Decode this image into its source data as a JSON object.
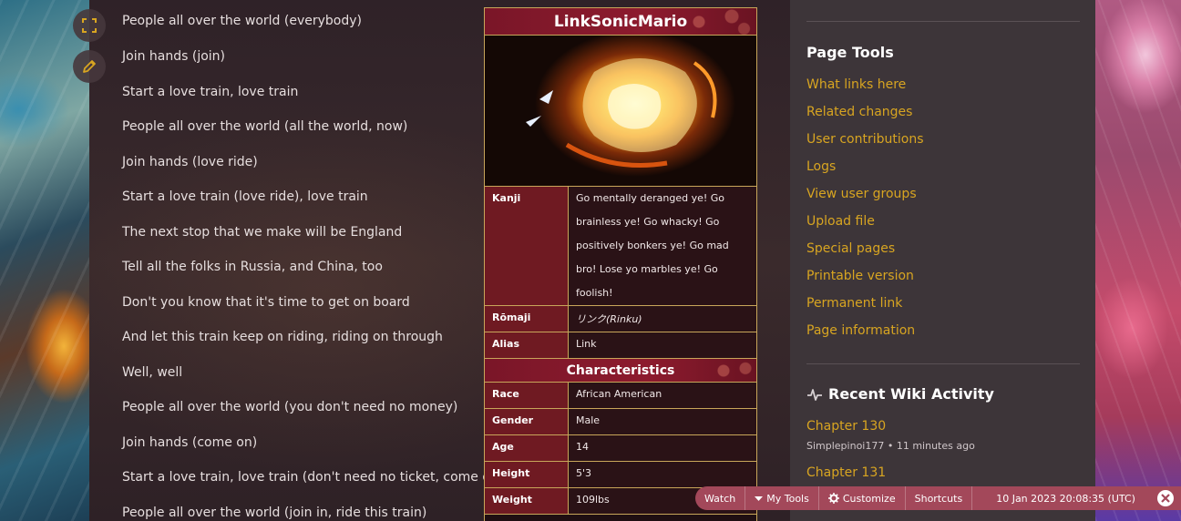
{
  "lyrics": [
    "People all over the world (everybody)",
    "Join hands (join)",
    "Start a love train, love train",
    "People all over the world (all the world, now)",
    "Join hands (love ride)",
    "Start a love train (love ride), love train",
    "The next stop that we make will be England",
    "Tell all the folks in Russia, and China, too",
    "Don't you know that it's time to get on board",
    "And let this train keep on riding, riding on through",
    "Well, well",
    "People all over the world (you don't need no money)",
    "Join hands (come on)",
    "Start a love train, love train (don't need no ticket, come on)",
    "People all over the world (join in, ride this train)"
  ],
  "infobox": {
    "title": "LinkSonicMario",
    "rows": [
      {
        "label": "Kanji",
        "value": "Go mentally deranged ye! Go brainless ye! Go whacky! Go positively bonkers ye! Go mad bro! Lose yo marbles ye! Go foolish!"
      },
      {
        "label": "Rōmaji",
        "value": "リンク(Rinku)"
      },
      {
        "label": "Alias",
        "value": "Link"
      }
    ],
    "section_title": "Characteristics",
    "characteristics": [
      {
        "label": "Race",
        "value": "African American"
      },
      {
        "label": "Gender",
        "value": "Male"
      },
      {
        "label": "Age",
        "value": "14"
      },
      {
        "label": "Height",
        "value": "5'3"
      },
      {
        "label": "Weight",
        "value": "109lbs"
      }
    ]
  },
  "page_tools": {
    "title": "Page Tools",
    "links": [
      "What links here",
      "Related changes",
      "User contributions",
      "Logs",
      "View user groups",
      "Upload file",
      "Special pages",
      "Printable version",
      "Permanent link",
      "Page information"
    ]
  },
  "recent_activity": {
    "title": "Recent Wiki Activity",
    "items": [
      {
        "title": "Chapter 130",
        "meta": "Simplepinoi177 • 11 minutes ago"
      },
      {
        "title": "Chapter 131",
        "meta": ""
      }
    ]
  },
  "toolbar": {
    "watch": "Watch",
    "my_tools": "My Tools",
    "customize": "Customize",
    "shortcuts": "Shortcuts",
    "timestamp": "10 Jan 2023 20:08:35 (UTC)"
  },
  "icons": {
    "fullscreen": "fullscreen-icon",
    "edit": "pencil-icon",
    "activity": "activity-icon",
    "my_tools": "caret-down-icon",
    "customize": "gear-icon",
    "close": "close-icon"
  },
  "colors": {
    "link": "#d8a521",
    "infobox_label_bg": "#6f1a22",
    "infobox_border": "#c8a65a",
    "toolbar_bg": "#a3485a",
    "sidebar_bg": "#3d3539"
  }
}
